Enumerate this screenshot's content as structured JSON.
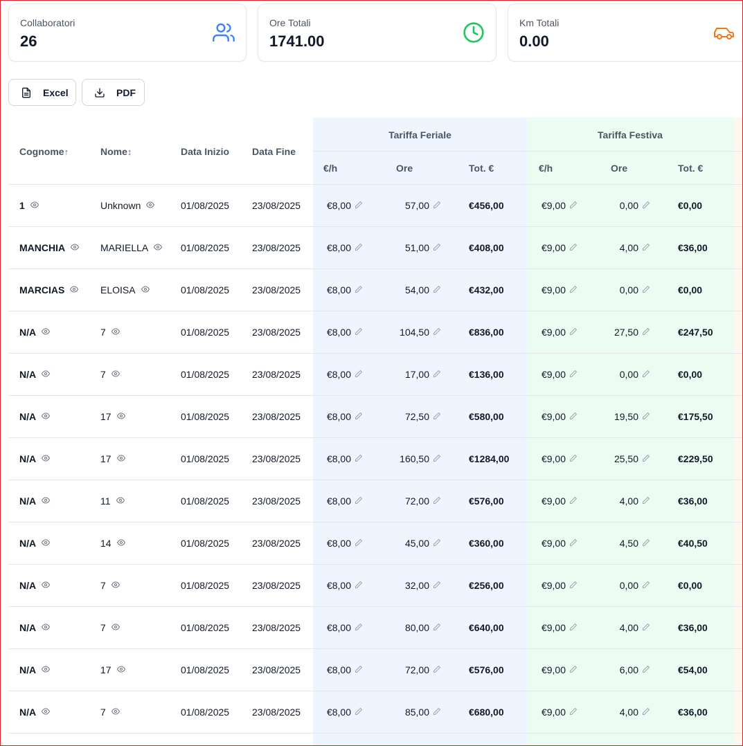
{
  "stats": [
    {
      "label": "Collaboratori",
      "value": "26",
      "icon": "users-icon",
      "color": "#3b82f6"
    },
    {
      "label": "Ore Totali",
      "value": "1741.00",
      "icon": "clock-icon",
      "color": "#22c55e"
    },
    {
      "label": "Km Totali",
      "value": "0.00",
      "icon": "car-icon",
      "color": "#f97316"
    }
  ],
  "actions": {
    "excel_label": "Excel",
    "pdf_label": "PDF"
  },
  "table": {
    "headers": {
      "cognome": "Cognome",
      "cognome_sort": "↑",
      "nome": "Nome",
      "nome_sort": "↕",
      "data_inizio": "Data Inizio",
      "data_fine": "Data Fine",
      "feriale": "Tariffa Feriale",
      "festiva": "Tariffa Festiva",
      "rate": "€/h",
      "ore": "Ore",
      "tot": "Tot. €",
      "rate2": "€/h",
      "ore2": "Ore",
      "tot2": "Tot. €"
    },
    "rows": [
      {
        "cognome": "1",
        "nome": "Unknown",
        "inizio": "01/08/2025",
        "fine": "23/08/2025",
        "fer_rate": "€8,00",
        "fer_ore": "57,00",
        "fer_tot": "€456,00",
        "fes_rate": "€9,00",
        "fes_ore": "0,00",
        "fes_tot": "€0,00"
      },
      {
        "cognome": "MANCHIA",
        "nome": "MARIELLA",
        "inizio": "01/08/2025",
        "fine": "23/08/2025",
        "fer_rate": "€8,00",
        "fer_ore": "51,00",
        "fer_tot": "€408,00",
        "fes_rate": "€9,00",
        "fes_ore": "4,00",
        "fes_tot": "€36,00"
      },
      {
        "cognome": "MARCIAS",
        "nome": "ELOISA",
        "inizio": "01/08/2025",
        "fine": "23/08/2025",
        "fer_rate": "€8,00",
        "fer_ore": "54,00",
        "fer_tot": "€432,00",
        "fes_rate": "€9,00",
        "fes_ore": "0,00",
        "fes_tot": "€0,00"
      },
      {
        "cognome": "N/A",
        "nome": "7",
        "inizio": "01/08/2025",
        "fine": "23/08/2025",
        "fer_rate": "€8,00",
        "fer_ore": "104,50",
        "fer_tot": "€836,00",
        "fes_rate": "€9,00",
        "fes_ore": "27,50",
        "fes_tot": "€247,50"
      },
      {
        "cognome": "N/A",
        "nome": "7",
        "inizio": "01/08/2025",
        "fine": "23/08/2025",
        "fer_rate": "€8,00",
        "fer_ore": "17,00",
        "fer_tot": "€136,00",
        "fes_rate": "€9,00",
        "fes_ore": "0,00",
        "fes_tot": "€0,00"
      },
      {
        "cognome": "N/A",
        "nome": "17",
        "inizio": "01/08/2025",
        "fine": "23/08/2025",
        "fer_rate": "€8,00",
        "fer_ore": "72,50",
        "fer_tot": "€580,00",
        "fes_rate": "€9,00",
        "fes_ore": "19,50",
        "fes_tot": "€175,50"
      },
      {
        "cognome": "N/A",
        "nome": "17",
        "inizio": "01/08/2025",
        "fine": "23/08/2025",
        "fer_rate": "€8,00",
        "fer_ore": "160,50",
        "fer_tot": "€1284,00",
        "fes_rate": "€9,00",
        "fes_ore": "25,50",
        "fes_tot": "€229,50"
      },
      {
        "cognome": "N/A",
        "nome": "11",
        "inizio": "01/08/2025",
        "fine": "23/08/2025",
        "fer_rate": "€8,00",
        "fer_ore": "72,00",
        "fer_tot": "€576,00",
        "fes_rate": "€9,00",
        "fes_ore": "4,00",
        "fes_tot": "€36,00"
      },
      {
        "cognome": "N/A",
        "nome": "14",
        "inizio": "01/08/2025",
        "fine": "23/08/2025",
        "fer_rate": "€8,00",
        "fer_ore": "45,00",
        "fer_tot": "€360,00",
        "fes_rate": "€9,00",
        "fes_ore": "4,50",
        "fes_tot": "€40,50"
      },
      {
        "cognome": "N/A",
        "nome": "7",
        "inizio": "01/08/2025",
        "fine": "23/08/2025",
        "fer_rate": "€8,00",
        "fer_ore": "32,00",
        "fer_tot": "€256,00",
        "fes_rate": "€9,00",
        "fes_ore": "0,00",
        "fes_tot": "€0,00"
      },
      {
        "cognome": "N/A",
        "nome": "7",
        "inizio": "01/08/2025",
        "fine": "23/08/2025",
        "fer_rate": "€8,00",
        "fer_ore": "80,00",
        "fer_tot": "€640,00",
        "fes_rate": "€9,00",
        "fes_ore": "4,00",
        "fes_tot": "€36,00"
      },
      {
        "cognome": "N/A",
        "nome": "17",
        "inizio": "01/08/2025",
        "fine": "23/08/2025",
        "fer_rate": "€8,00",
        "fer_ore": "72,00",
        "fer_tot": "€576,00",
        "fes_rate": "€9,00",
        "fes_ore": "6,00",
        "fes_tot": "€54,00"
      },
      {
        "cognome": "N/A",
        "nome": "7",
        "inizio": "01/08/2025",
        "fine": "23/08/2025",
        "fer_rate": "€8,00",
        "fer_ore": "85,00",
        "fer_tot": "€680,00",
        "fes_rate": "€9,00",
        "fes_ore": "4,00",
        "fes_tot": "€36,00"
      }
    ]
  }
}
